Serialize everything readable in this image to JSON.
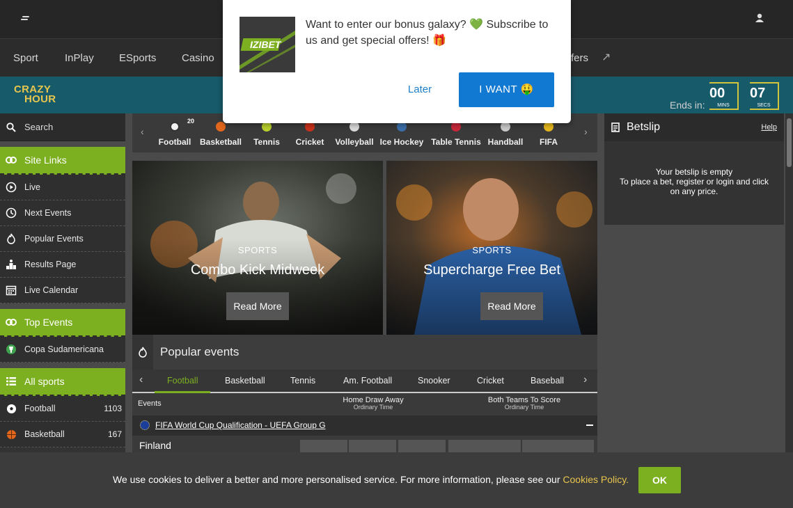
{
  "nav": {
    "items": [
      "Sport",
      "InPlay",
      "ESports",
      "Casino"
    ],
    "partial_item": "fers"
  },
  "crazy_hour": {
    "logo_line1": "CRAZY",
    "logo_line2": "HOUR",
    "ends_label": "Ends in:",
    "mins_value": "00",
    "mins_unit": "MINS",
    "secs_value": "07",
    "secs_unit": "SECS"
  },
  "sidebar": {
    "search_label": "Search",
    "site_links_label": "Site Links",
    "site_links": [
      {
        "label": "Live",
        "icon": "play-circle-icon"
      },
      {
        "label": "Next Events",
        "icon": "clock-icon"
      },
      {
        "label": "Popular Events",
        "icon": "fire-icon"
      },
      {
        "label": "Results Page",
        "icon": "podium-icon"
      },
      {
        "label": "Live Calendar",
        "icon": "calendar-icon"
      }
    ],
    "top_events_label": "Top Events",
    "top_events": [
      {
        "label": "Copa Sudamericana",
        "icon": "trophy-icon"
      }
    ],
    "all_sports_label": "All sports",
    "sports": [
      {
        "label": "Football",
        "count": "1103",
        "icon": "football-icon"
      },
      {
        "label": "Basketball",
        "count": "167",
        "icon": "basketball-icon"
      }
    ]
  },
  "sports_bar": {
    "items": [
      {
        "label": "Football",
        "badge": "20",
        "color": "#f2f2f2"
      },
      {
        "label": "Basketball",
        "badge": "",
        "color": "#e2661c"
      },
      {
        "label": "Tennis",
        "badge": "",
        "color": "#b9d02e"
      },
      {
        "label": "Cricket",
        "badge": "",
        "color": "#c8321c"
      },
      {
        "label": "Volleyball",
        "badge": "",
        "color": "#d9d9d9"
      },
      {
        "label": "Ice Hockey",
        "badge": "",
        "color": "#3b6ea8"
      },
      {
        "label": "Table Tennis",
        "badge": "",
        "color": "#c8283a"
      },
      {
        "label": "Handball",
        "badge": "",
        "color": "#c9c9c9"
      },
      {
        "label": "FIFA",
        "badge": "",
        "color": "#e5b81d"
      }
    ]
  },
  "promos": [
    {
      "tag": "SPORTS",
      "title": "Combo Kick Midweek",
      "button": "Read More"
    },
    {
      "tag": "SPORTS",
      "title": "Supercharge Free Bet",
      "button": "Read More"
    }
  ],
  "popular": {
    "title": "Popular events",
    "tabs": [
      "Football",
      "Basketball",
      "Tennis",
      "Am. Football",
      "Snooker",
      "Cricket",
      "Baseball"
    ],
    "active_tab": "Football",
    "events_label": "Events",
    "market1": "Home Draw Away",
    "market1_sub": "Ordinary Time",
    "market2": "Both Teams To Score",
    "market2_sub": "Ordinary Time",
    "competition": "FIFA World Cup Qualification - UEFA Group G",
    "match_team": "Finland"
  },
  "betslip": {
    "title": "Betslip",
    "help": "Help",
    "empty_line1": "Your betslip is empty",
    "empty_line2": "To place a bet, register or login and click on any price."
  },
  "popup": {
    "logo_text": "IZIBET",
    "message": "Want to enter our bonus galaxy? 💚 Subscribe to us and get special offers! 🎁",
    "later": "Later",
    "want": "I WANT 🤑"
  },
  "cookie": {
    "text": "We use cookies to deliver a better and more personalised service. For more information, please see our",
    "policy": "Cookies Policy.",
    "ok": "OK"
  },
  "colors": {
    "accent_green": "#7cb020",
    "popup_blue": "#1279d2",
    "crazy_teal": "#175a6a",
    "timer_gold": "#d4c43d"
  }
}
